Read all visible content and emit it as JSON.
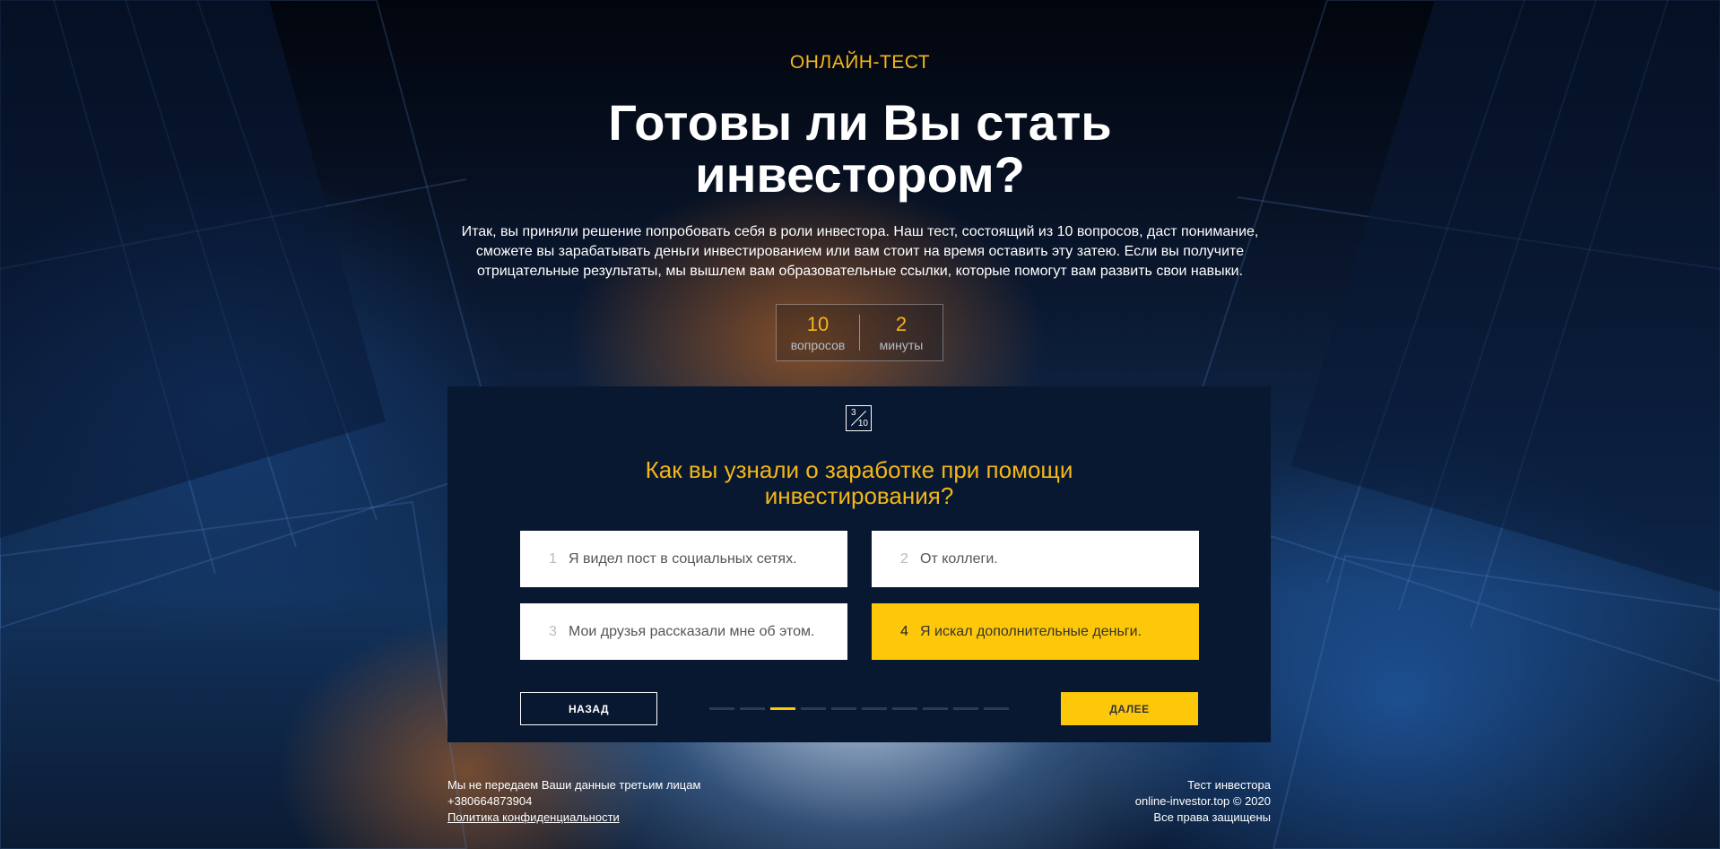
{
  "hero": {
    "kicker": "ОНЛАЙН-ТЕСТ",
    "title": "Готовы ли Вы стать инвестором?",
    "intro": "Итак, вы приняли решение попробовать себя в роли инвестора. Наш тест, состоящий из 10 вопросов, даст понимание, сможете вы зарабатывать деньги инвестированием или вам стоит на время оставить эту затею. Если вы получите отрицательные результаты, мы вышлем вам образовательные ссылки, которые помогут вам развить свои навыки."
  },
  "stats": {
    "questions_value": "10",
    "questions_label": "вопросов",
    "minutes_value": "2",
    "minutes_label": "минуты"
  },
  "quiz": {
    "counter_current": "3",
    "counter_total": "10",
    "question": "Как вы узнали о заработке при помощи инвестирования?",
    "answers": [
      {
        "num": "1",
        "text": "Я видел пост в социальных сетях.",
        "selected": false
      },
      {
        "num": "2",
        "text": "От коллеги.",
        "selected": false
      },
      {
        "num": "3",
        "text": "Мои друзья рассказали мне об этом.",
        "selected": false
      },
      {
        "num": "4",
        "text": "Я искал дополнительные деньги.",
        "selected": true
      }
    ],
    "back_label": "НАЗАД",
    "next_label": "ДАЛЕЕ",
    "progress_total": 10,
    "progress_current": 3
  },
  "footer": {
    "privacy_note": "Мы не передаем Ваши данные третьим лицам",
    "phone": "+380664873904",
    "policy_link": "Политика конфиденциальности",
    "site_name": "Тест инвестора",
    "copyright": "online-investor.top © 2020",
    "rights": "Все права защищены"
  },
  "colors": {
    "accent": "#fec80a",
    "accent_text": "#f4b619",
    "card": "#081830"
  }
}
